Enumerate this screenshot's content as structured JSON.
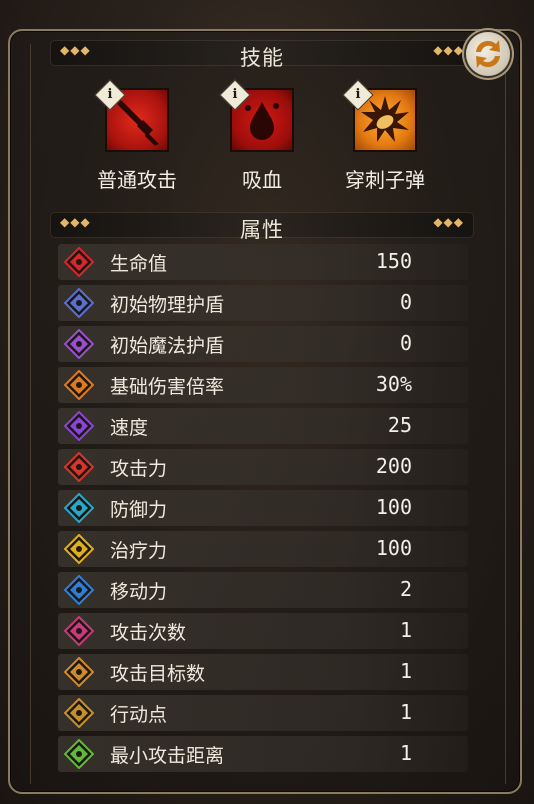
{
  "skills_section": {
    "title": "技能",
    "items": [
      {
        "name": "普通攻击",
        "icon": "sword-icon",
        "bg": "#c21a14",
        "info": "i"
      },
      {
        "name": "吸血",
        "icon": "blood-drop-icon",
        "bg": "#b5110f",
        "info": "i"
      },
      {
        "name": "穿刺子弹",
        "icon": "piercing-bullet-icon",
        "bg": "#e07010",
        "info": "i"
      }
    ]
  },
  "attributes_section": {
    "title": "属性",
    "rows": [
      {
        "label": "生命值",
        "value": "150",
        "icon": "heart-icon",
        "color": "#d8262a"
      },
      {
        "label": "初始物理护盾",
        "value": "0",
        "icon": "physical-shield-icon",
        "color": "#5a6fd0"
      },
      {
        "label": "初始魔法护盾",
        "value": "0",
        "icon": "magic-shield-icon",
        "color": "#9a4fd0"
      },
      {
        "label": "基础伤害倍率",
        "value": "30%",
        "icon": "damage-multiplier-icon",
        "color": "#e07a22"
      },
      {
        "label": "速度",
        "value": "25",
        "icon": "speed-icon",
        "color": "#8a44d8"
      },
      {
        "label": "攻击力",
        "value": "200",
        "icon": "attack-icon",
        "color": "#d8352a"
      },
      {
        "label": "防御力",
        "value": "100",
        "icon": "defense-icon",
        "color": "#2aa6c8"
      },
      {
        "label": "治疗力",
        "value": "100",
        "icon": "healing-icon",
        "color": "#e0b01a"
      },
      {
        "label": "移动力",
        "value": "2",
        "icon": "movement-icon",
        "color": "#2f7fd8"
      },
      {
        "label": "攻击次数",
        "value": "1",
        "icon": "attack-count-icon",
        "color": "#c83a7a"
      },
      {
        "label": "攻击目标数",
        "value": "1",
        "icon": "target-count-icon",
        "color": "#d08a2a"
      },
      {
        "label": "行动点",
        "value": "1",
        "icon": "action-point-icon",
        "color": "#c8902a"
      },
      {
        "label": "最小攻击距离",
        "value": "1",
        "icon": "min-range-icon",
        "color": "#62b83a"
      }
    ]
  },
  "swap_button": {
    "icon": "swap-icon"
  },
  "decor": {
    "dots": "◆◆◆"
  }
}
